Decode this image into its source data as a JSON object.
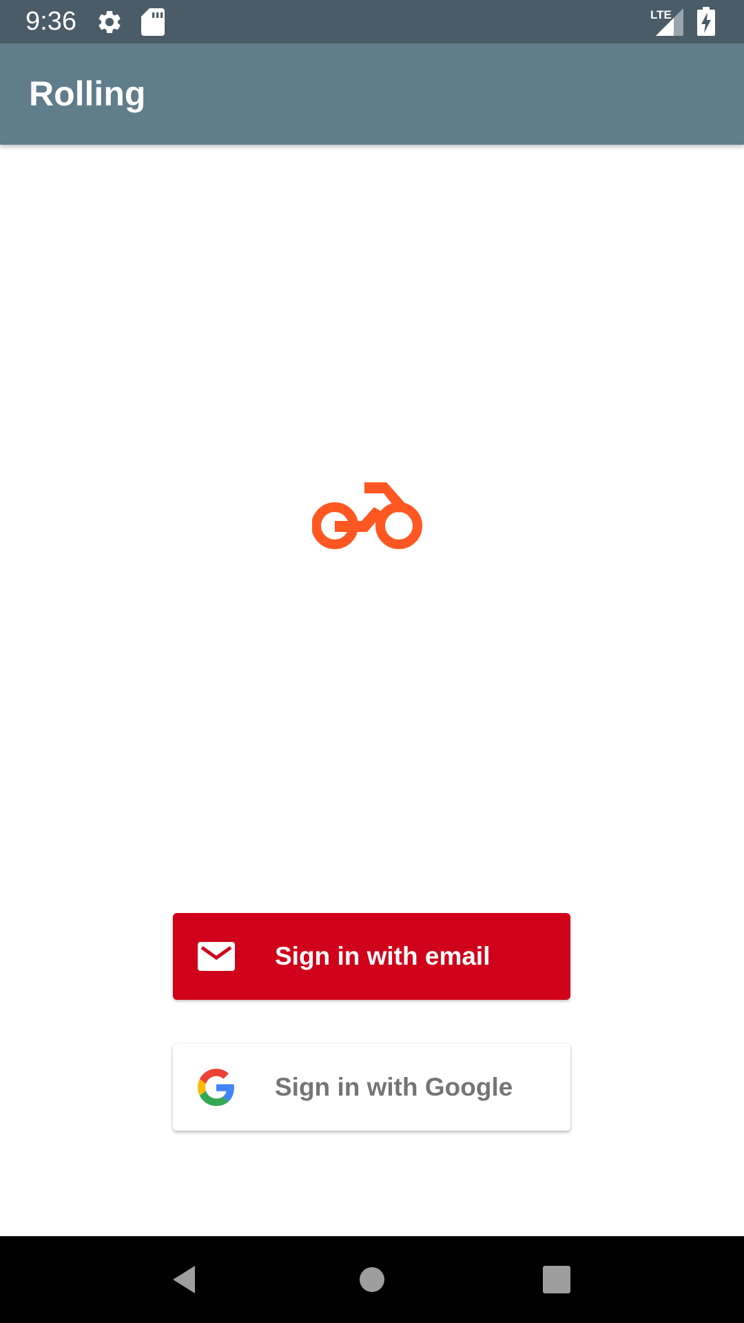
{
  "status_bar": {
    "time": "9:36",
    "icons": [
      "gear-icon",
      "sd-card-icon",
      "lte-signal-icon",
      "battery-charging-icon"
    ],
    "lte_label": "LTE",
    "background": "#4a5c68"
  },
  "app_bar": {
    "title": "Rolling",
    "background": "#607d8b"
  },
  "logo": {
    "icon": "motorcycle-icon",
    "color": "#ff5722"
  },
  "sign_in": {
    "email_button": {
      "label": "Sign in with email",
      "icon": "mail-icon",
      "background": "#d0021b"
    },
    "google_button": {
      "label": "Sign in with Google",
      "icon": "google-icon",
      "background": "#ffffff",
      "text_color": "#757575"
    }
  },
  "nav_bar": {
    "items": [
      "back-icon",
      "home-icon",
      "recents-icon"
    ]
  }
}
